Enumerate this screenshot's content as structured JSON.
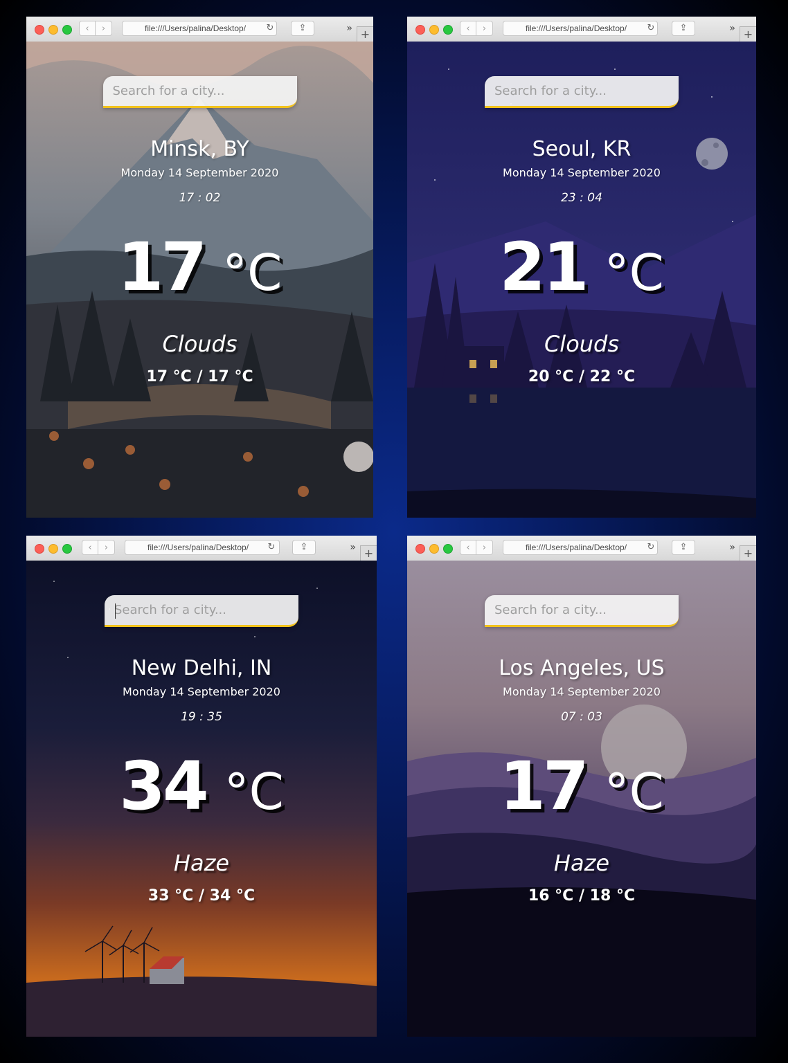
{
  "browser": {
    "address": "file:///Users/palina/Desktop/",
    "back_icon": "‹",
    "forward_icon": "›",
    "reload_icon": "↻",
    "share_icon": "⇪",
    "more_icon": "»",
    "newtab_icon": "+"
  },
  "search": {
    "placeholder": "Search for a city..."
  },
  "cards": [
    {
      "city": "Minsk, BY",
      "date": "Monday 14 September 2020",
      "time": "17 : 02",
      "temp": "17",
      "unit": "°C",
      "weather": "Clouds",
      "hilo": "17 °C / 17 °C"
    },
    {
      "city": "Seoul, KR",
      "date": "Monday 14 September 2020",
      "time": "23 : 04",
      "temp": "21",
      "unit": "°C",
      "weather": "Clouds",
      "hilo": "20 °C / 22 °C"
    },
    {
      "city": "New Delhi, IN",
      "date": "Monday 14 September 2020",
      "time": "19 : 35",
      "temp": "34",
      "unit": "°C",
      "weather": "Haze",
      "hilo": "33 °C / 34 °C"
    },
    {
      "city": "Los Angeles, US",
      "date": "Monday 14 September 2020",
      "time": "07 : 03",
      "temp": "17",
      "unit": "°C",
      "weather": "Haze",
      "hilo": "16 °C / 18 °C"
    }
  ],
  "colors": {
    "search_accent": "#f2c21b",
    "desktop_bg": "#061a5c"
  }
}
